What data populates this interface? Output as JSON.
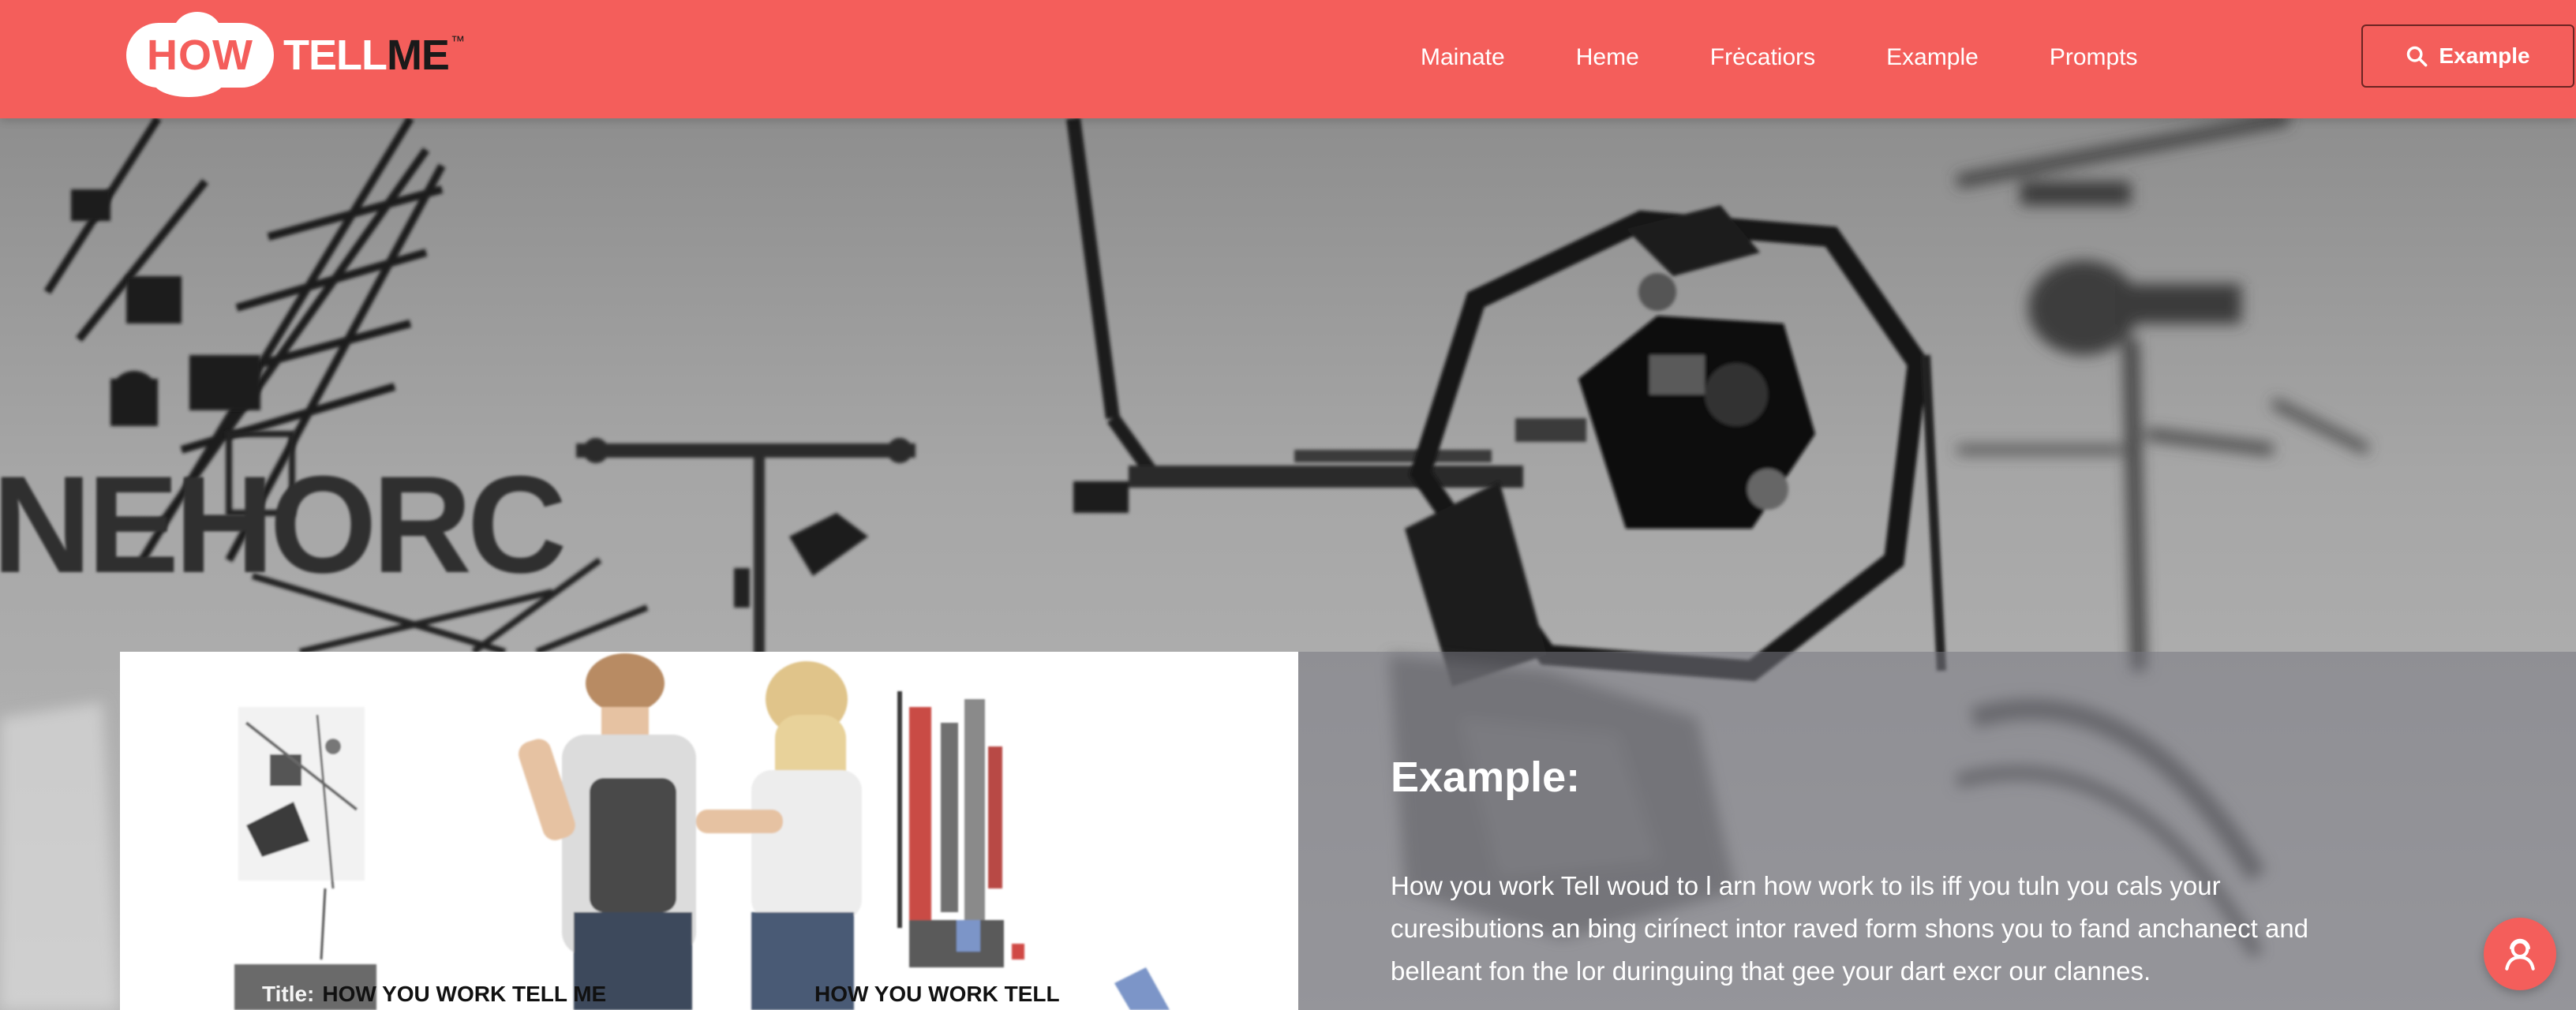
{
  "brand": {
    "logo_how": "HOW",
    "logo_tell": "TELL",
    "logo_me": "ME",
    "logo_tm": "™"
  },
  "nav": {
    "items": [
      {
        "label": "Mainate"
      },
      {
        "label": "Heme"
      },
      {
        "label": "Frėcatiors"
      },
      {
        "label": "Example"
      },
      {
        "label": "Prompts"
      }
    ]
  },
  "header_button": {
    "label": "Example",
    "icon": "search-icon"
  },
  "hero": {
    "background_text": "NEHORC"
  },
  "card": {
    "caption_label": "Title:",
    "caption_left": "HOW YOU WORK TELL ME",
    "caption_right": "HOW YOU WORK TELL"
  },
  "panel": {
    "title": "Example:",
    "body": "How you work Tell woud to l arn how work to ils iff you tuln you cals your curesibutions an bing cirínect intor raved form shons you to fand anchanect and belleant fon the lor duringuing that gee your dart excr our clannes."
  },
  "fab": {
    "icon": "support-agent-icon"
  },
  "colors": {
    "brand": "#f45e5b",
    "header_text": "#ffffff",
    "panel_overlay": "#787882"
  }
}
